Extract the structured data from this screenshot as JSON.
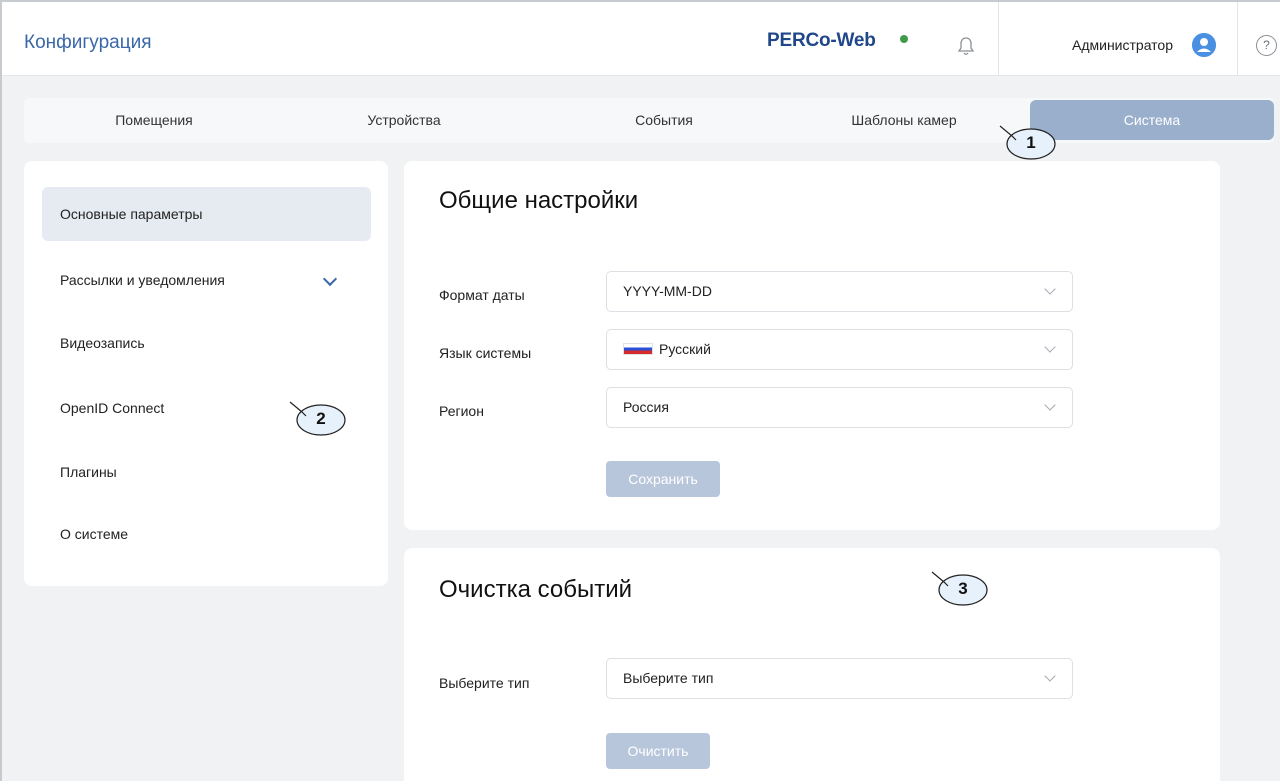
{
  "header": {
    "title": "Конфигурация",
    "logo": "PERCo-Web",
    "user_name": "Администратор",
    "help": "?"
  },
  "tabs": [
    {
      "label": "Помещения",
      "active": false
    },
    {
      "label": "Устройства",
      "active": false
    },
    {
      "label": "События",
      "active": false
    },
    {
      "label": "Шаблоны камер",
      "active": false
    },
    {
      "label": "Система",
      "active": true
    }
  ],
  "sidebar": {
    "items": [
      {
        "label": "Основные параметры",
        "active": true
      },
      {
        "label": "Рассылки и уведомления",
        "expandable": true
      },
      {
        "label": "Видеозапись"
      },
      {
        "label": "OpenID Connect"
      },
      {
        "label": "Плагины"
      },
      {
        "label": "О системе"
      }
    ]
  },
  "general": {
    "title": "Общие настройки",
    "fields": [
      {
        "label": "Формат даты",
        "value": "YYYY-MM-DD"
      },
      {
        "label": "Язык системы",
        "value": "Русский",
        "flag": "ru-flag-icon"
      },
      {
        "label": "Регион",
        "value": "Россия"
      }
    ],
    "save_label": "Сохранить"
  },
  "cleanup": {
    "title": "Очистка событий",
    "type_label": "Выберите тип",
    "type_value": "Выберите тип",
    "clear_label": "Очистить"
  },
  "callouts": [
    "1",
    "2",
    "3"
  ],
  "colors": {
    "accent": "#3a67a8",
    "active_tab": "#9aafcc",
    "disabled_button": "#b8c6db",
    "status_dot": "#3f9a4a"
  }
}
